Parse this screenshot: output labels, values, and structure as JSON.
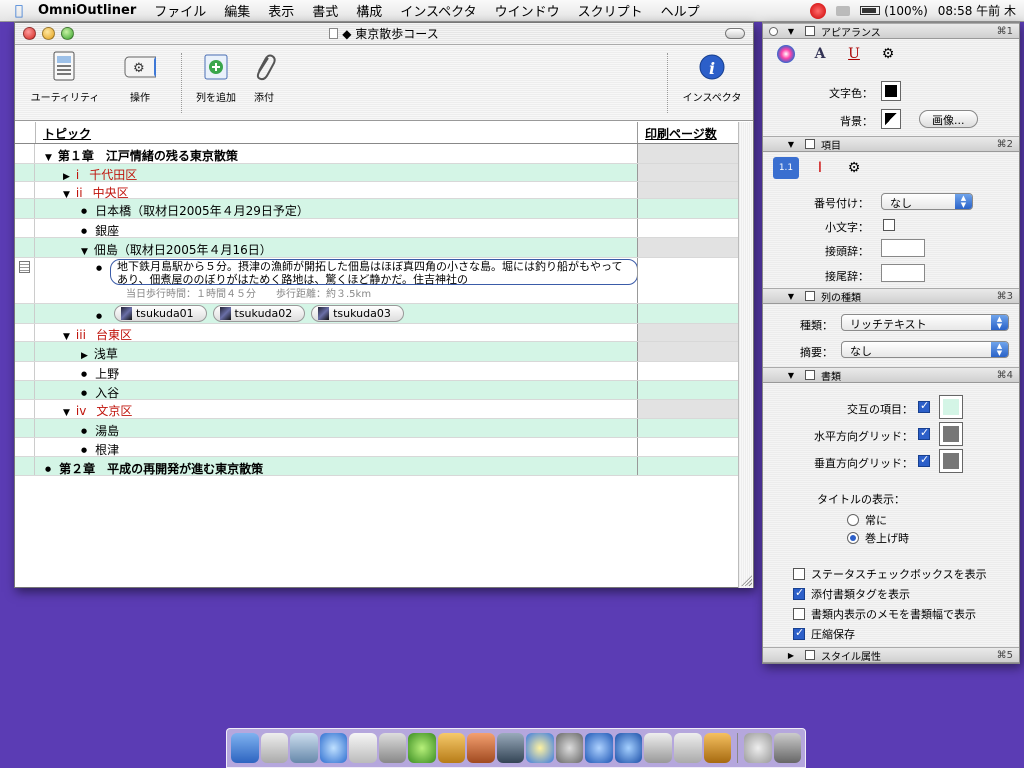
{
  "menubar": {
    "app": "OmniOutliner",
    "menus": [
      "ファイル",
      "編集",
      "表示",
      "書式",
      "構成",
      "インスペクタ",
      "ウインドウ",
      "スクリプト",
      "ヘルプ"
    ],
    "battery": "(100%)",
    "clock": "08:58 午前 木"
  },
  "window": {
    "title": "◆ 東京散歩コース",
    "toolbar": {
      "utility": "ユーティリティ",
      "action": "操作",
      "add_column": "列を追加",
      "attach": "添付",
      "inspector": "インスペクタ"
    },
    "columns": {
      "topic": "トピック",
      "print_pages": "印刷ページ数"
    },
    "rows": [
      {
        "text": "第１章　江戸情緒の残る東京散策"
      },
      {
        "numeral": "i",
        "text": "千代田区"
      },
      {
        "numeral": "ii",
        "text": "中央区"
      },
      {
        "text": "日本橋（取材日2005年４月29日予定）"
      },
      {
        "text": "銀座"
      },
      {
        "text": "佃島（取材日2005年４月16日）"
      },
      {
        "note": "地下鉄月島駅から５分。摂津の漁師が開拓した佃島はほぼ真四角の小さな島。堀には釣り船がもやってあり、佃煮屋ののぼりがはためく路地は、驚くほど静かだ。住吉神社の",
        "sub": "当日歩行時間：１時間４５分　　歩行距離：約３.5km"
      },
      {
        "attachments": [
          "tsukuda01",
          "tsukuda02",
          "tsukuda03"
        ]
      },
      {
        "numeral": "iii",
        "text": "台東区"
      },
      {
        "text": "浅草"
      },
      {
        "text": "上野"
      },
      {
        "text": "入谷"
      },
      {
        "numeral": "iv",
        "text": "文京区"
      },
      {
        "text": "湯島"
      },
      {
        "text": "根津"
      },
      {
        "text": "第２章　平成の再開発が進む東京散策"
      }
    ]
  },
  "inspector": {
    "appearance": {
      "title": "アピアランス",
      "key": "⌘1",
      "text_color_label": "文字色：",
      "background_label": "背景：",
      "image_button": "画像..."
    },
    "item": {
      "title": "項目",
      "key": "⌘2",
      "numbering_label": "番号付け：",
      "numbering_value": "なし",
      "lowercase_label": "小文字：",
      "prefix_label": "接頭辞：",
      "suffix_label": "接尾辞："
    },
    "column_type": {
      "title": "列の種類",
      "key": "⌘3",
      "type_label": "種類：",
      "type_value": "リッチテキスト",
      "summary_label": "摘要：",
      "summary_value": "なし"
    },
    "document": {
      "title": "書類",
      "key": "⌘4",
      "alternate_label": "交互の項目：",
      "hgrid_label": "水平方向グリッド：",
      "vgrid_label": "垂直方向グリッド：",
      "title_display_label": "タイトルの表示：",
      "radio_always": "常に",
      "radio_scroll": "巻上げ時",
      "show_status_checkbox": "ステータスチェックボックスを表示",
      "show_attachment_tags": "添付書類タグを表示",
      "show_notes_width": "書類内表示のメモを書類幅で表示",
      "compress_save": "圧縮保存"
    },
    "style": {
      "title": "スタイル属性",
      "key": "⌘5"
    }
  },
  "colors": {
    "desktop": "#5b3cb4",
    "alt_row": "#d4f5e6",
    "numeral_red": "#c0140c",
    "accent_blue": "#2c5fc9"
  }
}
